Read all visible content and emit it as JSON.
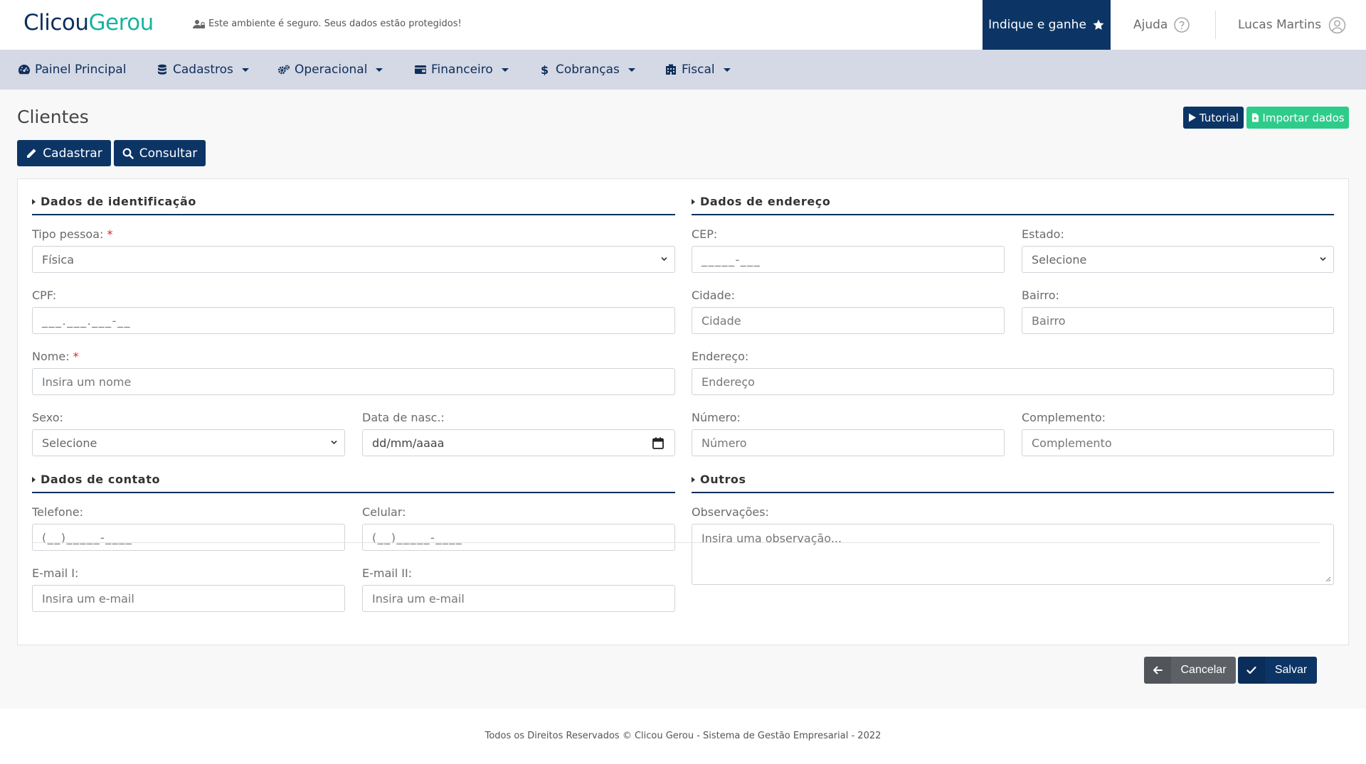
{
  "header": {
    "logo_part1": "Clicou",
    "logo_part2": "Gerou",
    "secure_text": "Este ambiente é seguro. Seus dados estão protegidos!",
    "indique_label": "Indique e ganhe",
    "ajuda_label": "Ajuda",
    "user_name": "Lucas Martins"
  },
  "nav": {
    "items": [
      {
        "label": "Painel Principal",
        "icon": "dashboard-icon",
        "dropdown": false
      },
      {
        "label": "Cadastros",
        "icon": "database-icon",
        "dropdown": true
      },
      {
        "label": "Operacional",
        "icon": "gears-icon",
        "dropdown": true
      },
      {
        "label": "Financeiro",
        "icon": "wallet-icon",
        "dropdown": true
      },
      {
        "label": "Cobranças",
        "icon": "dollar-icon",
        "dropdown": true
      },
      {
        "label": "Fiscal",
        "icon": "building-icon",
        "dropdown": true
      }
    ]
  },
  "page": {
    "title": "Clientes",
    "tutorial_label": "Tutorial",
    "import_label": "Importar dados",
    "cadastrar_label": "Cadastrar",
    "consultar_label": "Consultar"
  },
  "form": {
    "ident": {
      "title": "Dados de identificação",
      "tipo_label": "Tipo pessoa:",
      "tipo_value": "Física",
      "cpf_label": "CPF:",
      "cpf_placeholder": "___.___.___-__",
      "nome_label": "Nome:",
      "nome_placeholder": "Insira um nome",
      "sexo_label": "Sexo:",
      "sexo_value": "Selecione",
      "nasc_label": "Data de nasc.:",
      "nasc_placeholder": "dd/mm/aaaa"
    },
    "endereco": {
      "title": "Dados de endereço",
      "cep_label": "CEP:",
      "cep_placeholder": "_____-___",
      "estado_label": "Estado:",
      "estado_value": "Selecione",
      "cidade_label": "Cidade:",
      "cidade_placeholder": "Cidade",
      "bairro_label": "Bairro:",
      "bairro_placeholder": "Bairro",
      "endereco_label": "Endereço:",
      "endereco_placeholder": "Endereço",
      "numero_label": "Número:",
      "numero_placeholder": "Número",
      "complemento_label": "Complemento:",
      "complemento_placeholder": "Complemento"
    },
    "contato": {
      "title": "Dados de contato",
      "telefone_label": "Telefone:",
      "telefone_placeholder": "(__)_____-____",
      "celular_label": "Celular:",
      "celular_placeholder": "(__)_____-____",
      "email1_label": "E-mail I:",
      "email1_placeholder": "Insira um e-mail",
      "email2_label": "E-mail II:",
      "email2_placeholder": "Insira um e-mail"
    },
    "outros": {
      "title": "Outros",
      "obs_label": "Observações:",
      "obs_placeholder": "Insira uma observação..."
    },
    "actions": {
      "cancel_label": "Cancelar",
      "save_label": "Salvar"
    }
  },
  "footer": {
    "text": "Todos os Direitos Reservados © Clicou Gerou - Sistema de Gestão Empresarial - 2022"
  },
  "colors": {
    "primary": "#0c3566",
    "accent_green": "#2ecc8a",
    "nav_bg": "#d5d8e5",
    "logo_teal": "#17b3a3"
  }
}
